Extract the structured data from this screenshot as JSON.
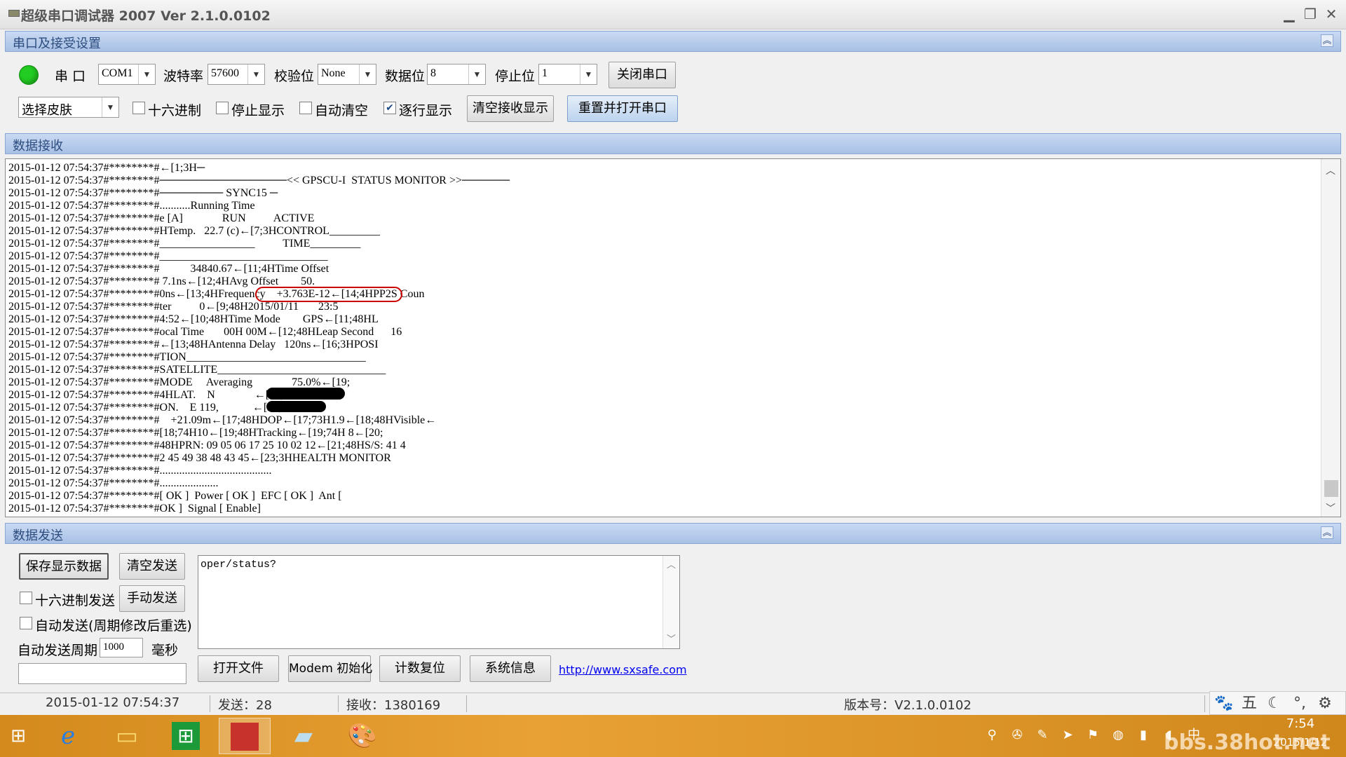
{
  "window": {
    "title": "超级串口调试器 2007    Ver 2.1.0.0102",
    "min_icon": "minimize-icon",
    "max_icon": "restore-icon",
    "close_icon": "close-icon"
  },
  "serial_section": {
    "header": "串口及接受设置",
    "port_label": "串  口",
    "port_value": "COM1",
    "baud_label": "波特率",
    "baud_value": "57600",
    "parity_label": "校验位",
    "parity_value": "None",
    "databits_label": "数据位",
    "databits_value": "8",
    "stopbits_label": "停止位",
    "stopbits_value": "1",
    "close_port_button": "关闭串口",
    "skin_value": "选择皮肤",
    "hex_label": "十六进制",
    "hex_checked": false,
    "stop_display_label": "停止显示",
    "stop_display_checked": false,
    "auto_clear_label": "自动清空",
    "auto_clear_checked": false,
    "line_display_label": "逐行显示",
    "line_display_checked": true,
    "clear_recv_button": "清空接收显示",
    "reset_open_button": "重置并打开串口",
    "status_led_color": "#22cc22"
  },
  "recv_section": {
    "header": "数据接收",
    "lines": [
      "2015-01-12 07:54:37#********#←[1;3H─",
      "2015-01-12 07:54:37#********#────────────────<< GPSCU-I  STATUS MONITOR >>──────",
      "2015-01-12 07:54:37#********#──────── SYNC15 ─",
      "2015-01-12 07:54:37#********#...........Running Time",
      "2015-01-12 07:54:37#********#e [A]              RUN          ACTIVE",
      "2015-01-12 07:54:37#********#HTemp.   22.7 (c)←[7;3HCONTROL_________",
      "2015-01-12 07:54:37#********#_________________          TIME_________",
      "2015-01-12 07:54:37#********#______________________________",
      "2015-01-12 07:54:37#********#           34840.67←[11;4HTime Offset",
      "2015-01-12 07:54:37#********# 7.1ns←[12;4HAvg Offset        50.",
      "2015-01-12 07:54:37#********#0ns←[13;4HFrequency    +3.763E-12←[14;4HPP2S Coun",
      "2015-01-12 07:54:37#********#ter          0←[9;48H2015/01/11       23:5",
      "2015-01-12 07:54:37#********#4:52←[10;48HTime Mode        GPS←[11;48HL",
      "2015-01-12 07:54:37#********#ocal Time       00H 00M←[12;48HLeap Second      16",
      "2015-01-12 07:54:37#********#←[13;48HAntenna Delay   120ns←[16;3HPOSI",
      "2015-01-12 07:54:37#********#TION________________________________",
      "2015-01-12 07:54:37#********#SATELLITE______________________________",
      "2015-01-12 07:54:37#********#MODE     Averaging              75.0%←[19;",
      "2015-01-12 07:54:37#********#4HLAT.    N              ←[20;4HL",
      "2015-01-12 07:54:37#********#ON.    E 119,            ←[21;4HHGT.",
      "2015-01-12 07:54:37#********#    +21.09m←[17;48HDOP←[17;73H1.9←[18;48HVisible←",
      "2015-01-12 07:54:37#********#[18;74H10←[19;48HTracking←[19;74H 8←[20;",
      "2015-01-12 07:54:37#********#48HPRN: 09 05 06 17 25 10 02 12←[21;48HS/S: 41 4",
      "2015-01-12 07:54:37#********#2 45 49 38 48 43 45←[23;3HHEALTH MONITOR",
      "2015-01-12 07:54:37#********#........................................",
      "2015-01-12 07:54:37#********#.....................",
      "2015-01-12 07:54:37#********#[ OK ]  Power [ OK ]  EFC [ OK ]  Ant [",
      "2015-01-12 07:54:37#********#OK ]  Signal [ Enable]"
    ]
  },
  "send_section": {
    "header": "数据发送",
    "save_button": "保存显示数据",
    "clear_send_button": "清空发送",
    "hex_send_label": "十六进制发送",
    "hex_send_checked": false,
    "manual_send_button": "手动发送",
    "auto_send_label": "自动发送(周期修改后重选)",
    "auto_send_checked": false,
    "period_label": "自动发送周期",
    "period_value": "1000",
    "period_unit": "毫秒",
    "send_text": "oper/status?",
    "open_file_button": "打开文件",
    "modem_init_button": "Modem 初始化",
    "count_reset_button": "计数复位",
    "sys_info_button": "系统信息",
    "link": "http://www.sxsafe.com"
  },
  "statusbar": {
    "datetime": "2015-01-12 07:54:37",
    "sent": "发送：28",
    "received": "接收：1380169",
    "version": "版本号：V2.1.0.0102"
  },
  "ime_bar": {
    "items": [
      "paw-icon",
      "五",
      "moon-icon",
      "dots-icon",
      "gear-icon"
    ],
    "wu": "五"
  },
  "taskbar": {
    "items": [
      "start-icon",
      "ie-icon",
      "explorer-icon",
      "store-icon",
      "app-icon",
      "notepad-icon",
      "paint-icon"
    ],
    "clock_time": "7:54",
    "clock_date": "2015/1/12",
    "ime_lang": "中",
    "watermark": "bbs.38hot.net",
    "accent": "#e39a2e"
  }
}
